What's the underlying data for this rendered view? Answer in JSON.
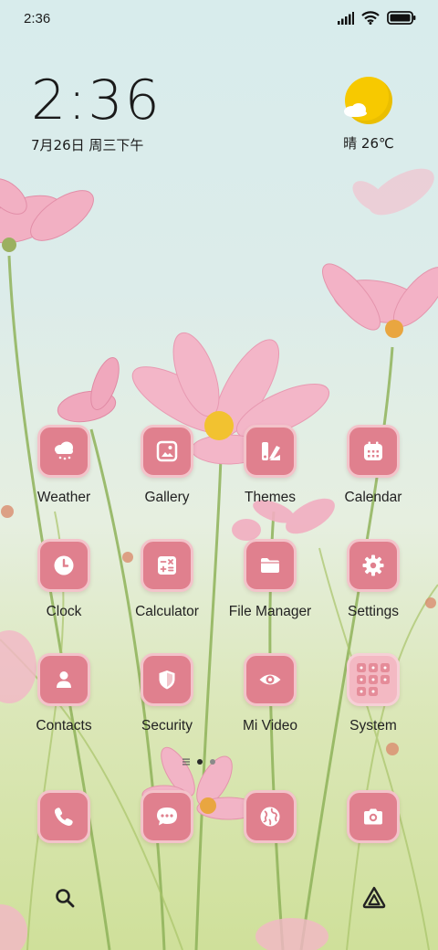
{
  "status_bar": {
    "time": "2:36"
  },
  "clock_widget": {
    "time": "2:36",
    "date": "7月26日 周三下午"
  },
  "weather_widget": {
    "text": "晴 26℃"
  },
  "apps": [
    {
      "label": "Weather",
      "icon": "cloud-rain-icon"
    },
    {
      "label": "Gallery",
      "icon": "image-icon"
    },
    {
      "label": "Themes",
      "icon": "brush-palette-icon"
    },
    {
      "label": "Calendar",
      "icon": "calendar-icon"
    },
    {
      "label": "Clock",
      "icon": "clock-icon"
    },
    {
      "label": "Calculator",
      "icon": "calculator-icon"
    },
    {
      "label": "File Manager",
      "icon": "folder-icon"
    },
    {
      "label": "Settings",
      "icon": "gear-icon"
    },
    {
      "label": "Contacts",
      "icon": "person-icon"
    },
    {
      "label": "Security",
      "icon": "shield-icon"
    },
    {
      "label": "Mi Video",
      "icon": "eye-icon"
    },
    {
      "label": "System",
      "icon": "folder-grid-icon"
    }
  ],
  "dock": [
    {
      "icon": "phone-icon"
    },
    {
      "icon": "message-icon"
    },
    {
      "icon": "globe-icon"
    },
    {
      "icon": "camera-icon"
    }
  ],
  "search_bar": {
    "left_icon": "search-icon",
    "right_icon": "assistant-icon"
  },
  "colors": {
    "icon_bg": "#e0808e",
    "icon_border": "#f3c3ca",
    "sun": "#f7c900"
  }
}
